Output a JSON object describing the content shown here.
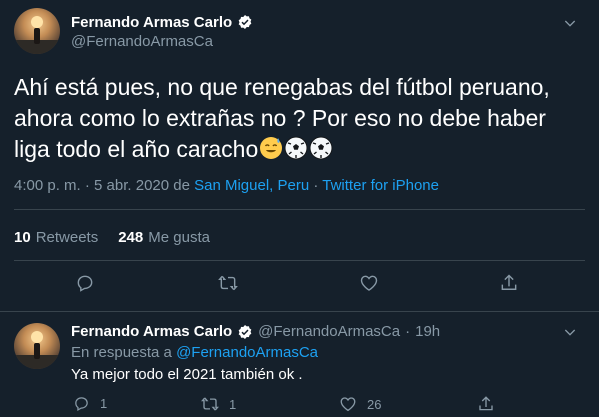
{
  "main_tweet": {
    "display_name": "Fernando Armas Carlo",
    "handle": "@FernandoArmasCa",
    "text": "Ahí está pues, no que  renegabas del fútbol peruano, ahora como lo extrañas no ? Por eso no debe haber liga todo el año caracho",
    "emojis": [
      "sweat-smile-emoji",
      "soccer-ball-emoji",
      "soccer-ball-emoji"
    ],
    "time": "4:00 p. m. · 5 abr. 2020 de ",
    "location": "San Miguel, Peru",
    "separator": " · ",
    "source": "Twitter for iPhone",
    "retweets_count": "10",
    "retweets_label": "Retweets",
    "likes_count": "248",
    "likes_label": "Me gusta"
  },
  "reply": {
    "display_name": "Fernando Armas Carlo",
    "handle": "@FernandoArmasCa",
    "dot": "·",
    "age": "19h",
    "reply_prefix": "En respuesta a ",
    "reply_to": "@FernandoArmasCa",
    "text": "Ya mejor todo el 2021 también ok .",
    "reply_count": "1",
    "retweet_count": "1",
    "like_count": "26"
  },
  "colors": {
    "background": "#15202b",
    "muted": "#8899a6",
    "link": "#1da1f2",
    "divider": "#38444d"
  }
}
